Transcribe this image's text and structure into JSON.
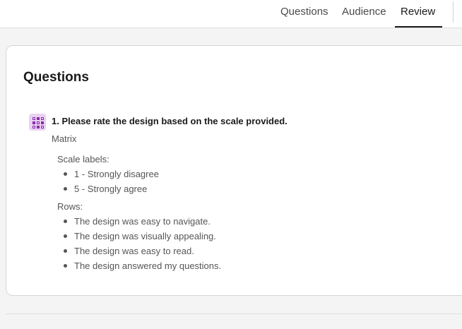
{
  "nav": {
    "tabs": [
      {
        "label": "Questions"
      },
      {
        "label": "Audience"
      },
      {
        "label": "Review"
      }
    ],
    "active_tab": "Review"
  },
  "review": {
    "section_title": "Questions",
    "question": {
      "title": "1. Please rate the design based on the scale provided.",
      "type": "Matrix",
      "icon": "matrix-grid-icon",
      "scale_labels_heading": "Scale labels:",
      "scale_labels": [
        "1 - Strongly disagree",
        "5 - Strongly agree"
      ],
      "rows_heading": "Rows:",
      "rows": [
        "The design was easy to navigate.",
        "The design was visually appealing.",
        "The design was easy to read.",
        "The design answered my questions."
      ]
    }
  },
  "colors": {
    "icon_bg": "#ead1f3",
    "icon_fg": "#8a2ba8",
    "active_tab_underline": "#1a1a1a"
  }
}
